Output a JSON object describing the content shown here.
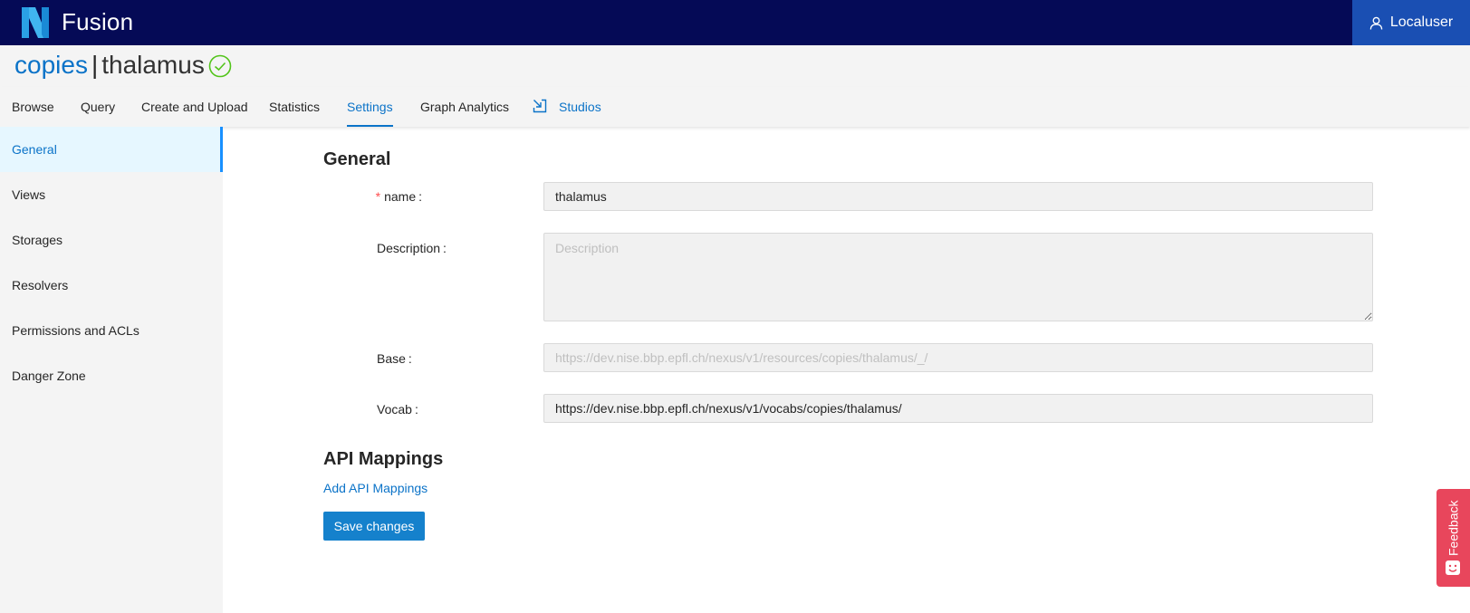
{
  "app": {
    "name": "Fusion",
    "user": "Localuser"
  },
  "title": {
    "org": "copies",
    "separator": "|",
    "project": "thalamus"
  },
  "tabs": [
    {
      "label": "Browse"
    },
    {
      "label": "Query"
    },
    {
      "label": "Create and Upload"
    },
    {
      "label": "Statistics"
    },
    {
      "label": "Settings"
    },
    {
      "label": "Graph Analytics"
    },
    {
      "label": "Studios"
    }
  ],
  "sidebar": {
    "items": [
      {
        "label": "General"
      },
      {
        "label": "Views"
      },
      {
        "label": "Storages"
      },
      {
        "label": "Resolvers"
      },
      {
        "label": "Permissions and ACLs"
      },
      {
        "label": "Danger Zone"
      }
    ]
  },
  "general": {
    "title": "General",
    "name_label": "name",
    "name_required_mark": "*",
    "name_value": "thalamus",
    "description_label": "Description",
    "description_placeholder": "Description",
    "description_value": "",
    "base_label": "Base",
    "base_placeholder": "https://dev.nise.bbp.epfl.ch/nexus/v1/resources/copies/thalamus/_/",
    "vocab_label": "Vocab",
    "vocab_value": "https://dev.nise.bbp.epfl.ch/nexus/v1/vocabs/copies/thalamus/",
    "colon": ":"
  },
  "api_mappings": {
    "title": "API Mappings",
    "add_label": "Add API Mappings"
  },
  "actions": {
    "save_label": "Save changes"
  },
  "feedback": {
    "label": "Feedback"
  },
  "colors": {
    "topbar": "#050a56",
    "user_button": "#1a4fb3",
    "accent": "#0b73c8",
    "save_button": "#1581cc",
    "feedback": "#e8465c",
    "success": "#52c41a"
  },
  "icons": {
    "logo": "nexus-logo-icon",
    "user": "user-icon",
    "status": "check-circle-icon",
    "studios": "studio-icon",
    "feedback": "smile-icon"
  }
}
